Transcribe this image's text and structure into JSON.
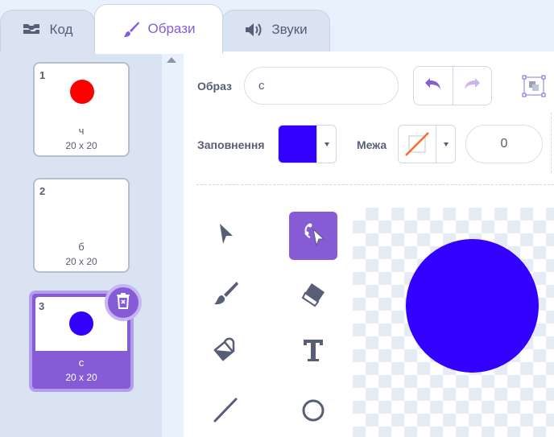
{
  "tabs": [
    {
      "label": "Код",
      "icon": "code-blocks-icon"
    },
    {
      "label": "Образи",
      "icon": "brush-icon",
      "selected": true
    },
    {
      "label": "Звуки",
      "icon": "speaker-icon"
    }
  ],
  "costumes": [
    {
      "number": "1",
      "name": "ч",
      "size": "20 x 20",
      "color": "#ff0000"
    },
    {
      "number": "2",
      "name": "б",
      "size": "20 x 20",
      "color": "#ffffff"
    },
    {
      "number": "3",
      "name": "с",
      "size": "20 x 20",
      "color": "#3300ff",
      "selected": true
    }
  ],
  "editor": {
    "costume_label": "Образ",
    "costume_name": "с",
    "fill_label": "Заповнення",
    "fill_color": "#3300ff",
    "outline_label": "Межа",
    "outline_width": "0"
  },
  "tools": [
    "select-tool",
    "reshape-tool",
    "brush-tool",
    "eraser-tool",
    "fill-tool",
    "text-tool",
    "line-tool",
    "circle-tool"
  ],
  "active_tool": "reshape-tool",
  "colors": {
    "accent": "#855cd6",
    "shape_fill": "#3300ff"
  }
}
